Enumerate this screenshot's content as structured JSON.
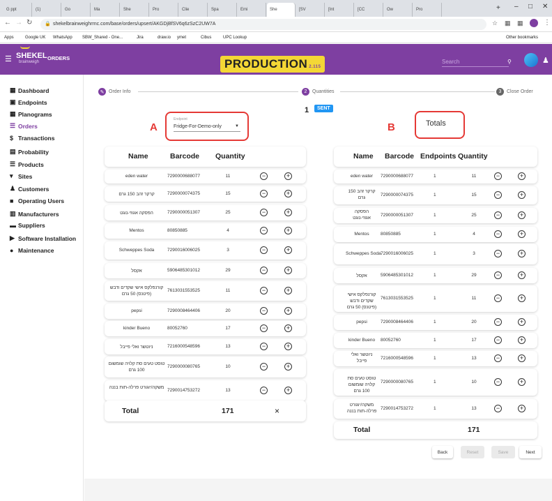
{
  "browser": {
    "tabs": [
      "G ppt",
      "(1)",
      "Go",
      "Ma",
      "She",
      "Pro",
      "Clie",
      "Spa",
      "Emi",
      "She",
      "[SV",
      "[Int",
      "[CC",
      "Ow",
      "Pro"
    ],
    "url": "shekelbrainweighrrnc.com/base/orders/upsert/AKGDjBfSV6q6zSzC2UW7A",
    "bookmarks": [
      "Apps",
      "Google UK",
      "WhatsApp",
      "SBW_Shared - One...",
      "Jira",
      "draw.io",
      "ymet",
      "Cibus",
      "UPC Lookup"
    ],
    "other_bookmarks": "Other bookmarks"
  },
  "app": {
    "logo": "SHEKEL",
    "logo_sub": "brainweigh",
    "section": "ORDERS",
    "env_badge": "PRODUCTION",
    "env_version": "2.115",
    "search_placeholder": "Search"
  },
  "sidebar": {
    "items": [
      {
        "label": "Dashboard",
        "icon": "dashboard-icon"
      },
      {
        "label": "Endpoints",
        "icon": "endpoint-icon"
      },
      {
        "label": "Planograms",
        "icon": "grid-icon"
      },
      {
        "label": "Orders",
        "icon": "list-icon",
        "active": true
      },
      {
        "label": "Transactions",
        "icon": "dollar-icon"
      },
      {
        "label": "Probability",
        "icon": "probability-icon"
      },
      {
        "label": "Products",
        "icon": "products-icon"
      },
      {
        "label": "Sites",
        "icon": "location-icon"
      },
      {
        "label": "Customers",
        "icon": "people-icon"
      },
      {
        "label": "Operating Users",
        "icon": "user-icon"
      },
      {
        "label": "Manufacturers",
        "icon": "factory-icon"
      },
      {
        "label": "Suppliers",
        "icon": "truck-icon"
      },
      {
        "label": "Software Installation",
        "icon": "play-icon"
      },
      {
        "label": "Maintenance",
        "icon": "info-icon"
      }
    ]
  },
  "stepper": {
    "step1": "Order Info",
    "step2_num": "2",
    "step2": "Quantities",
    "step3_num": "3",
    "step3": "Close Order"
  },
  "order": {
    "number": "1",
    "status": "SENT"
  },
  "annotations": {
    "a": "A",
    "b": "B"
  },
  "endpoint": {
    "label": "Endpoint",
    "value": "Fridge-For-Demo-only"
  },
  "totals_label": "Totals",
  "left_table": {
    "headers": {
      "name": "Name",
      "barcode": "Barcode",
      "quantity": "Quantity"
    },
    "rows": [
      {
        "name": "eden water",
        "barcode": "7290000688077",
        "quantity": "11"
      },
      {
        "name": "קרקר זהב 150 גרם",
        "barcode": "7290000074375",
        "quantity": "15"
      },
      {
        "name": "הפסקה אגוזי-נוגט",
        "barcode": "7290000051307",
        "quantity": "25"
      },
      {
        "name": "Mentos",
        "barcode": "80850885",
        "quantity": "4"
      },
      {
        "name": "Schweppes Soda",
        "barcode": "7290016006025",
        "quantity": "3"
      },
      {
        "name": "אקסל",
        "barcode": "5906485301012",
        "quantity": "29"
      },
      {
        "name": "קורנפלקס אישי שקדים ודבש (פיטנס) 50 גרם",
        "barcode": "7613031553525",
        "quantity": "11"
      },
      {
        "name": "pepsi",
        "barcode": "7290008464406",
        "quantity": "20"
      },
      {
        "name": "kinder Bueno",
        "barcode": "80052760",
        "quantity": "17"
      },
      {
        "name": "ניוטשר ואלי פייבל",
        "barcode": "7216000548596",
        "quantity": "13"
      },
      {
        "name": "טוסט טעים סת קלויה שומשום 100 גרם",
        "barcode": "7290000080765",
        "quantity": "10"
      },
      {
        "name": "משקה/יוגורט פרלה-תות בננה",
        "barcode": "7290014753272",
        "quantity": "13"
      }
    ],
    "total_label": "Total",
    "total_value": "171",
    "clear": "×"
  },
  "right_table": {
    "headers": {
      "name": "Name",
      "barcode": "Barcode",
      "endpoints": "Endpoints",
      "quantity": "Quantity"
    },
    "rows": [
      {
        "name": "eden water",
        "barcode": "7290000688077",
        "endpoints": "1",
        "quantity": "11"
      },
      {
        "name": "קרקר זהב 150 גרם",
        "barcode": "7290000074375",
        "endpoints": "1",
        "quantity": "15"
      },
      {
        "name": "הפסקה אגוזי-נוגט",
        "barcode": "7290000051307",
        "endpoints": "1",
        "quantity": "25"
      },
      {
        "name": "Mentos",
        "barcode": "80850885",
        "endpoints": "1",
        "quantity": "4"
      },
      {
        "name": "Schweppes Soda",
        "barcode": "7290016006025",
        "endpoints": "1",
        "quantity": "3"
      },
      {
        "name": "אקסל",
        "barcode": "5906485301012",
        "endpoints": "1",
        "quantity": "29"
      },
      {
        "name": "קורנפלקס אישי שקדים ודבש (פיטנס) 50 גרם",
        "barcode": "7613031553525",
        "endpoints": "1",
        "quantity": "11"
      },
      {
        "name": "pepsi",
        "barcode": "7290008464406",
        "endpoints": "1",
        "quantity": "20"
      },
      {
        "name": "kinder Bueno",
        "barcode": "80052760",
        "endpoints": "1",
        "quantity": "17"
      },
      {
        "name": "ניוטשר ואלי פייבל",
        "barcode": "7216000548596",
        "endpoints": "1",
        "quantity": "13"
      },
      {
        "name": "טוסט טעים סת קלויה שומשום 100 גרם",
        "barcode": "7290000080765",
        "endpoints": "1",
        "quantity": "10"
      },
      {
        "name": "משקה/יוגורט פרלה-תות בננה",
        "barcode": "7290014753272",
        "endpoints": "1",
        "quantity": "13"
      }
    ],
    "total_label": "Total",
    "total_value": "171"
  },
  "buttons": {
    "back": "Back",
    "reset": "Reset",
    "save": "Save",
    "next": "Next"
  },
  "colors": {
    "brand": "#7e3fa1",
    "badge": "#f4d735",
    "annotation": "#e53935",
    "sent": "#2196f3"
  }
}
